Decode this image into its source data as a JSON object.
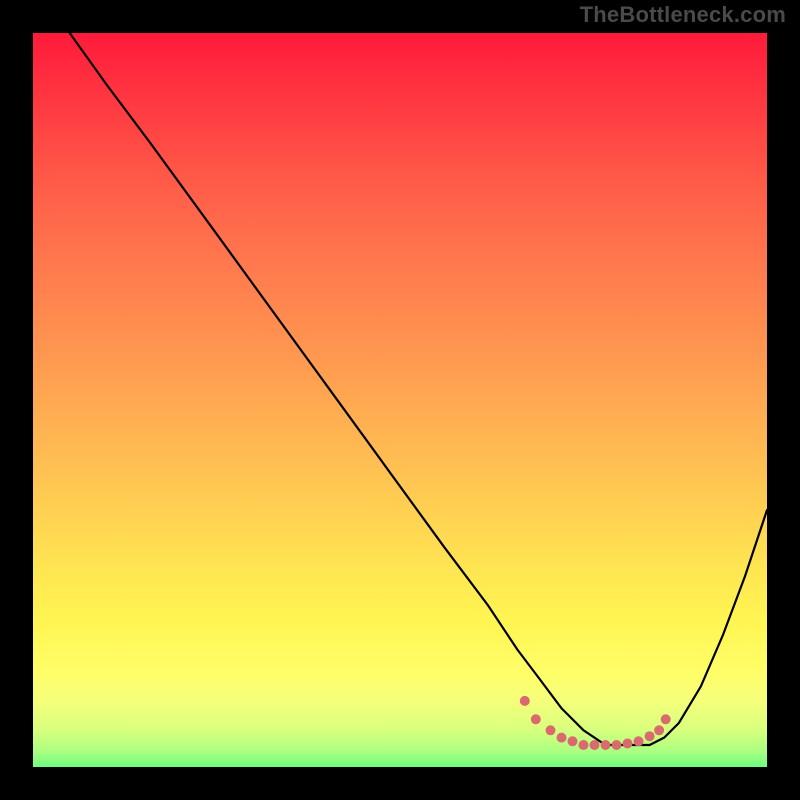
{
  "watermark": "TheBottleneck.com",
  "chart_data": {
    "type": "line",
    "title": "",
    "xlabel": "",
    "ylabel": "",
    "xlim": [
      0,
      100
    ],
    "ylim": [
      0,
      100
    ],
    "series": [
      {
        "name": "curve",
        "x": [
          5,
          10,
          16,
          24,
          32,
          40,
          48,
          56,
          62,
          66,
          69,
          72,
          75,
          78,
          81,
          84,
          86,
          88,
          91,
          94,
          97,
          100
        ],
        "values": [
          100,
          93,
          85,
          74,
          63,
          52,
          41,
          30,
          22,
          16,
          12,
          8,
          5,
          3,
          3,
          3,
          4,
          6,
          11,
          18,
          26,
          35
        ]
      }
    ],
    "markers": {
      "name": "low-band-dots",
      "color": "#d96b6e",
      "x": [
        67,
        68.5,
        70.5,
        72,
        73.5,
        75,
        76.5,
        78,
        79.5,
        81,
        82.5,
        84,
        85.3,
        86.2
      ],
      "values": [
        9,
        6.5,
        5,
        4,
        3.5,
        3,
        3,
        3,
        3,
        3.2,
        3.5,
        4.2,
        5,
        6.5
      ]
    },
    "gradient_stops": [
      {
        "pos": 0,
        "color": "#ff1a3a"
      },
      {
        "pos": 50,
        "color": "#ffb050"
      },
      {
        "pos": 80,
        "color": "#fff552"
      },
      {
        "pos": 100,
        "color": "#6dff7e"
      }
    ]
  }
}
